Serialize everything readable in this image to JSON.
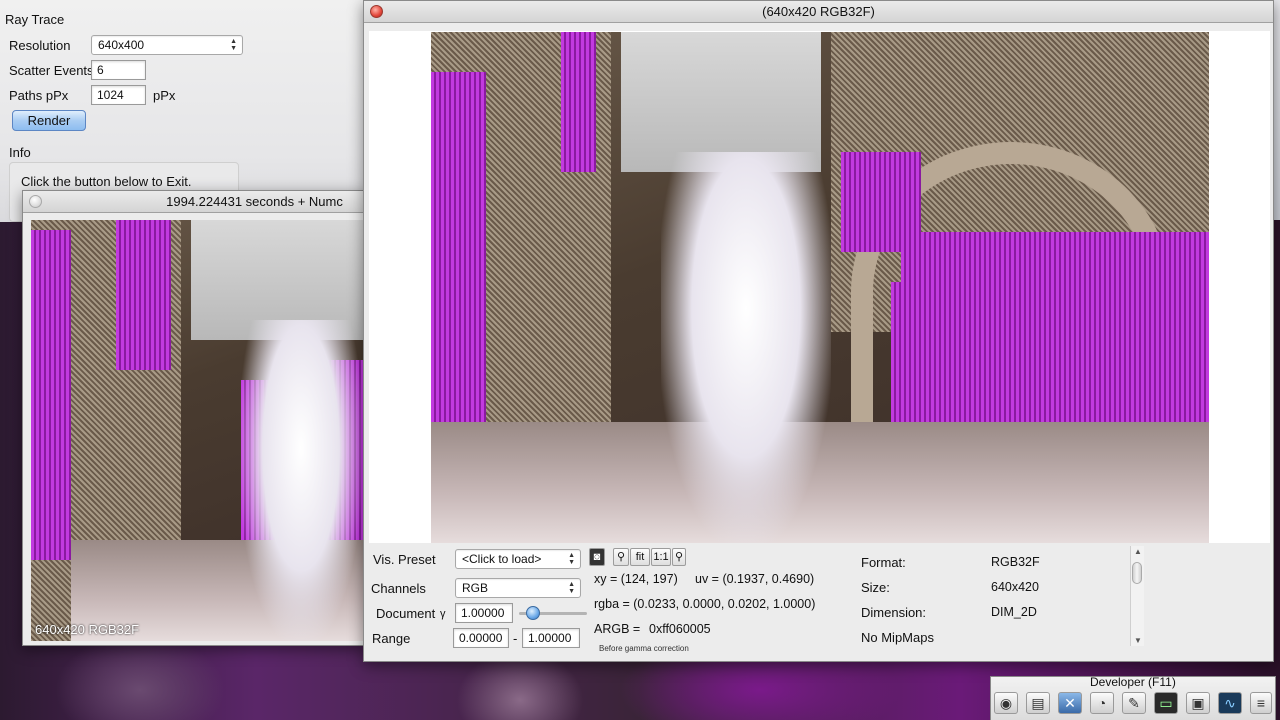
{
  "ray_trace_panel": {
    "title": "Ray Trace",
    "resolution_label": "Resolution",
    "resolution_value": "640x400",
    "scatter_label": "Scatter Events",
    "scatter_value": "6",
    "paths_label": "Paths pPx",
    "paths_value": "1024",
    "paths_unit": "pPx",
    "render_button": "Render",
    "info_label": "Info",
    "info_text": "Click the button below to Exit."
  },
  "preview_window": {
    "title": "1994.224431 seconds + Numc",
    "overlay": "640x420 RGB32F"
  },
  "main_window": {
    "title": "(640x420 RGB32F)"
  },
  "inspector": {
    "vis_preset_label": "Vis. Preset",
    "vis_preset_value": "<Click to load>",
    "channels_label": "Channels",
    "channels_value": "RGB",
    "document_label": "Document",
    "gamma_symbol": "γ",
    "gamma_value": "1.00000",
    "range_label": "Range",
    "range_min": "0.00000",
    "range_sep": "-",
    "range_max": "1.00000",
    "tool_fit": "fit",
    "tool_one": "1:1",
    "xy": "xy =  (124, 197)",
    "uv": "uv =  (0.1937, 0.4690)",
    "rgba": "rgba =  (0.0233, 0.0000, 0.0202, 1.0000)",
    "argb_label": "ARGB =",
    "argb_value": "0xff060005",
    "gamma_note": "Before gamma correction",
    "format_label": "Format:",
    "format_value": "RGB32F",
    "size_label": "Size:",
    "size_value": "640x420",
    "dimension_label": "Dimension:",
    "dimension_value": "DIM_2D",
    "mipmaps": "No MipMaps"
  },
  "developer_bar": {
    "title": "Developer (F11)",
    "icons": [
      "camera-icon",
      "clapper-icon",
      "tools-icon",
      "gauge-icon",
      "note-icon",
      "terminal-icon",
      "windows-icon",
      "monitor-icon",
      "document-icon"
    ]
  }
}
